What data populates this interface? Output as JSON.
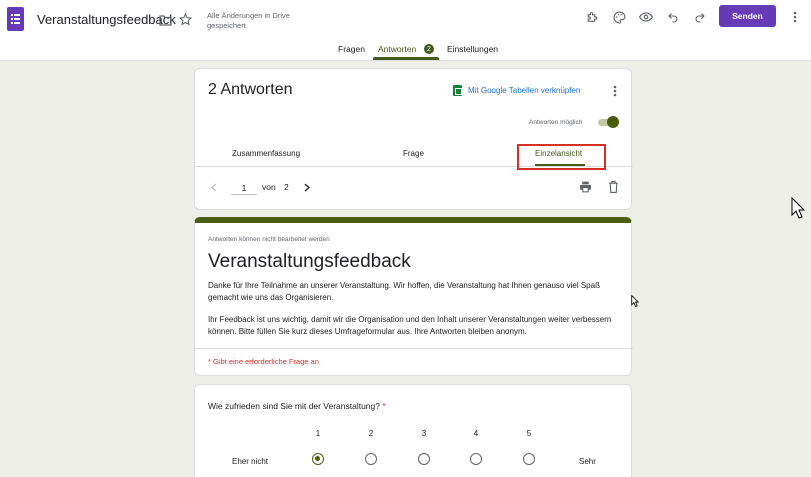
{
  "header": {
    "doc_title": "Veranstaltungsfeedback",
    "save_status": "Alle Änderungen in Drive gespeichert",
    "send_label": "Senden",
    "accent_color": "#673ab7"
  },
  "tabs": [
    {
      "label": "Fragen"
    },
    {
      "label": "Antworten",
      "count": "2"
    },
    {
      "label": "Einstellungen"
    }
  ],
  "responses": {
    "title": "2 Antworten",
    "sheets_link": "Mit Google Tabellen verknüpfen",
    "accepting_label": "Antworten möglich",
    "accepting": true,
    "subtabs": [
      "Zusammenfassung",
      "Frage",
      "Einzelansicht"
    ],
    "current_page": "1",
    "of_label": "von",
    "total_pages": "2"
  },
  "form": {
    "notice": "Antworten können nicht bearbeitet werden",
    "title": "Veranstaltungsfeedback",
    "desc1": "Danke für Ihre Teilnahme an unserer Veranstaltung. Wir hoffen, die Veranstaltung hat Ihnen genauso viel Spaß gemacht wie uns das Organisieren.",
    "desc2": "Ihr Feedback ist uns wichtig, damit wir die Organisation und den Inhalt unserer Veranstaltungen weiter verbessern können. Bitte füllen Sie kurz dieses Umfrageformular aus. Ihre Antworten bleiben anonym.",
    "required_note": "* Gibt eine erforderliche Frage an",
    "theme_color": "#4b5e0f"
  },
  "question": {
    "text": "Wie zufrieden sind Sie mit der Veranstaltung?",
    "required_mark": "*",
    "scale": [
      "1",
      "2",
      "3",
      "4",
      "5"
    ],
    "selected": "1",
    "low_label": "Eher nicht",
    "high_label": "Sehr"
  }
}
